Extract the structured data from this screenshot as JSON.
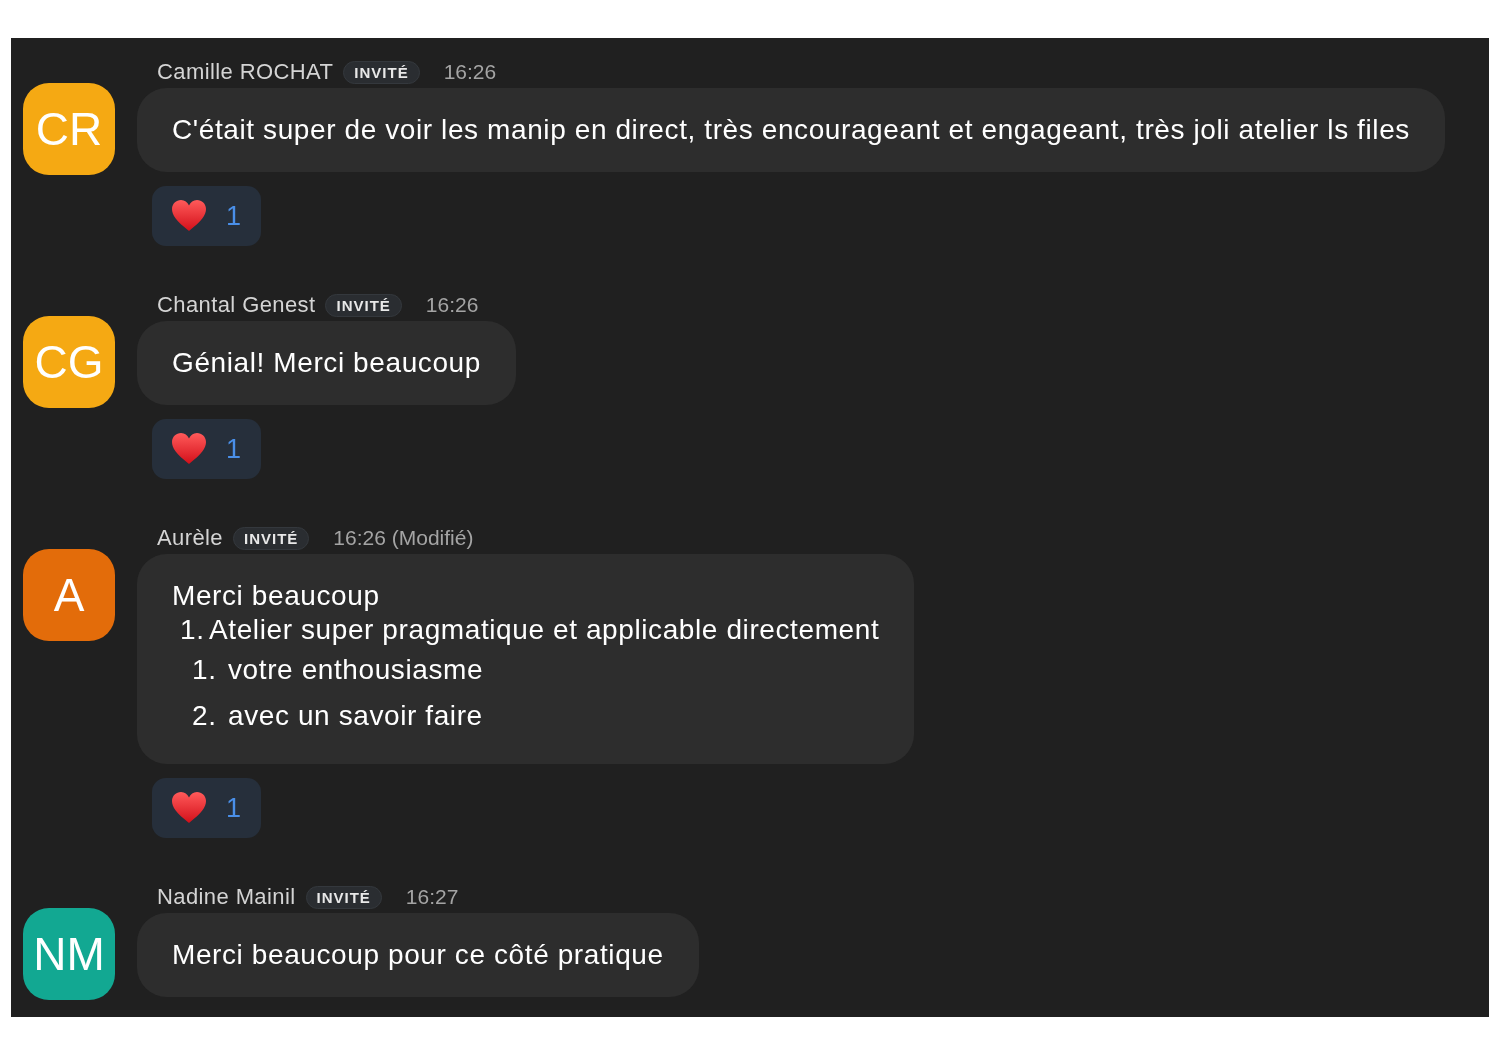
{
  "messages": [
    {
      "initials": "CR",
      "color": "#f5a913",
      "author": "Camille ROCHAT",
      "badge": "INVITÉ",
      "time": "16:26",
      "body": [
        {
          "kind": "paragraph",
          "text": "C'était super de voir les manip en direct, très encourageant et engageant, très joli atelier ls files"
        }
      ],
      "reaction": {
        "count": "1"
      }
    },
    {
      "initials": "CG",
      "color": "#f5a913",
      "author": "Chantal Genest",
      "badge": "INVITÉ",
      "time": "16:26",
      "body": [
        {
          "kind": "paragraph",
          "text": "Génial! Merci beaucoup"
        }
      ],
      "reaction": {
        "count": "1"
      }
    },
    {
      "initials": "A",
      "color": "#e36c0a",
      "author": "Aurèle",
      "badge": "INVITÉ",
      "time": "16:26 (Modifié)",
      "body": [
        {
          "kind": "paragraph",
          "text": "Merci beaucoup"
        },
        {
          "kind": "list",
          "items": [
            {
              "marker": "1.",
              "text": "Atelier super pragmatique et applicable directement",
              "children": [
                {
                  "marker": "1.",
                  "text": "votre enthousiasme"
                },
                {
                  "marker": "2.",
                  "text": "avec un savoir faire"
                }
              ]
            }
          ]
        }
      ],
      "reaction": {
        "count": "1"
      }
    },
    {
      "initials": "NM",
      "color": "#12a892",
      "author": "Nadine Mainil",
      "badge": "INVITÉ",
      "time": "16:27",
      "body": [
        {
          "kind": "paragraph",
          "text": "Merci beaucoup pour ce côté pratique"
        }
      ]
    }
  ]
}
